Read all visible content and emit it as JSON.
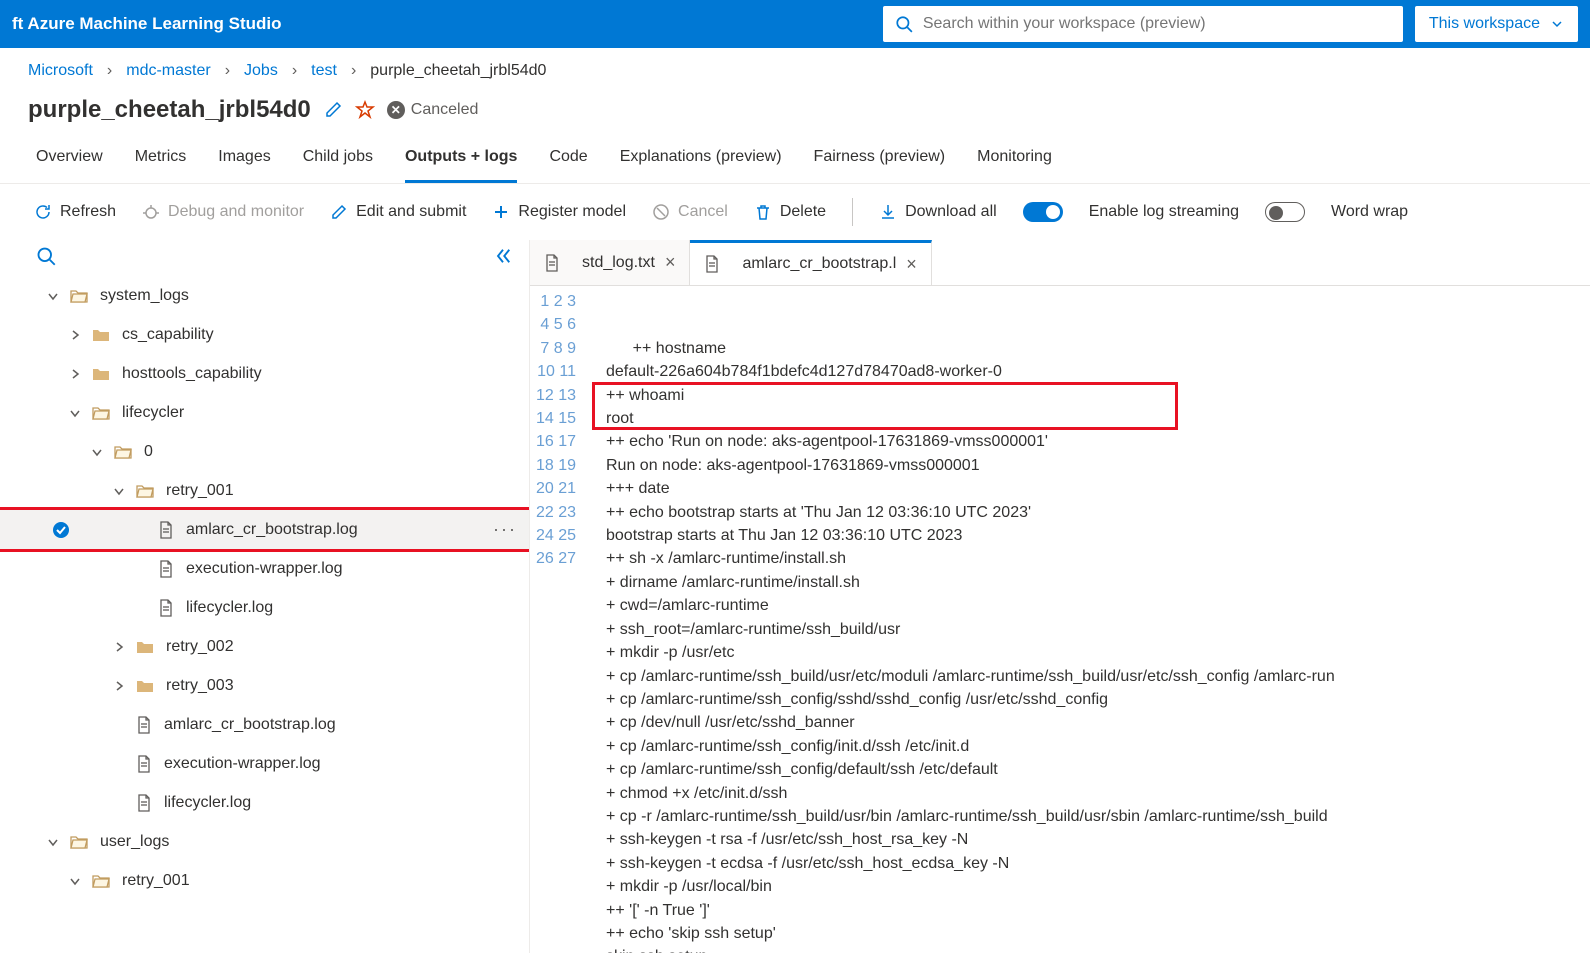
{
  "header": {
    "brand": "ft Azure Machine Learning Studio",
    "search_placeholder": "Search within your workspace (preview)",
    "scope": "This workspace"
  },
  "breadcrumb": [
    "Microsoft",
    "mdc-master",
    "Jobs",
    "test",
    "purple_cheetah_jrbl54d0"
  ],
  "title": "purple_cheetah_jrbl54d0",
  "status": "Canceled",
  "tabs": [
    "Overview",
    "Metrics",
    "Images",
    "Child jobs",
    "Outputs + logs",
    "Code",
    "Explanations (preview)",
    "Fairness (preview)",
    "Monitoring"
  ],
  "active_tab": 4,
  "toolbar": {
    "refresh": "Refresh",
    "debug": "Debug and monitor",
    "edit": "Edit and submit",
    "register": "Register model",
    "cancel": "Cancel",
    "delete": "Delete",
    "download": "Download all",
    "log_stream": "Enable log streaming",
    "wrap": "Word wrap"
  },
  "tree": [
    {
      "d": 0,
      "t": "folder-open",
      "exp": "down",
      "label": "system_logs"
    },
    {
      "d": 1,
      "t": "folder",
      "exp": "right",
      "label": "cs_capability"
    },
    {
      "d": 1,
      "t": "folder",
      "exp": "right",
      "label": "hosttools_capability"
    },
    {
      "d": 1,
      "t": "folder-open",
      "exp": "down",
      "label": "lifecycler"
    },
    {
      "d": 2,
      "t": "folder-open",
      "exp": "down",
      "label": "0"
    },
    {
      "d": 3,
      "t": "folder-open",
      "exp": "down",
      "label": "retry_001"
    },
    {
      "d": 4,
      "t": "file",
      "label": "amlarc_cr_bootstrap.log",
      "selected": true
    },
    {
      "d": 4,
      "t": "file",
      "label": "execution-wrapper.log"
    },
    {
      "d": 4,
      "t": "file",
      "label": "lifecycler.log"
    },
    {
      "d": 3,
      "t": "folder",
      "exp": "right",
      "label": "retry_002"
    },
    {
      "d": 3,
      "t": "folder",
      "exp": "right",
      "label": "retry_003"
    },
    {
      "d": 3,
      "t": "file",
      "label": "amlarc_cr_bootstrap.log"
    },
    {
      "d": 3,
      "t": "file",
      "label": "execution-wrapper.log"
    },
    {
      "d": 3,
      "t": "file",
      "label": "lifecycler.log"
    },
    {
      "d": 0,
      "t": "folder-open",
      "exp": "down",
      "label": "user_logs"
    },
    {
      "d": 1,
      "t": "folder-open",
      "exp": "down",
      "label": "retry_001"
    }
  ],
  "editor_tabs": [
    {
      "label": "std_log.txt",
      "active": false
    },
    {
      "label": "amlarc_cr_bootstrap.l",
      "active": true
    }
  ],
  "code": [
    "++ hostname",
    "default-226a604b784f1bdefc4d127d78470ad8-worker-0",
    "++ whoami",
    "root",
    "++ echo 'Run on node: aks-agentpool-17631869-vmss000001'",
    "Run on node: aks-agentpool-17631869-vmss000001",
    "+++ date",
    "++ echo bootstrap starts at 'Thu Jan 12 03:36:10 UTC 2023'",
    "bootstrap starts at Thu Jan 12 03:36:10 UTC 2023",
    "++ sh -x /amlarc-runtime/install.sh",
    "+ dirname /amlarc-runtime/install.sh",
    "+ cwd=/amlarc-runtime",
    "+ ssh_root=/amlarc-runtime/ssh_build/usr",
    "+ mkdir -p /usr/etc",
    "+ cp /amlarc-runtime/ssh_build/usr/etc/moduli /amlarc-runtime/ssh_build/usr/etc/ssh_config /amlarc-run",
    "+ cp /amlarc-runtime/ssh_config/sshd/sshd_config /usr/etc/sshd_config",
    "+ cp /dev/null /usr/etc/sshd_banner",
    "+ cp /amlarc-runtime/ssh_config/init.d/ssh /etc/init.d",
    "+ cp /amlarc-runtime/ssh_config/default/ssh /etc/default",
    "+ chmod +x /etc/init.d/ssh",
    "+ cp -r /amlarc-runtime/ssh_build/usr/bin /amlarc-runtime/ssh_build/usr/sbin /amlarc-runtime/ssh_build",
    "+ ssh-keygen -t rsa -f /usr/etc/ssh_host_rsa_key -N",
    "+ ssh-keygen -t ecdsa -f /usr/etc/ssh_host_ecdsa_key -N",
    "+ mkdir -p /usr/local/bin",
    "++ '[' -n True ']'",
    "++ echo 'skip ssh setup'",
    "skip ssh setup"
  ],
  "highlight_lines": [
    5,
    6
  ]
}
